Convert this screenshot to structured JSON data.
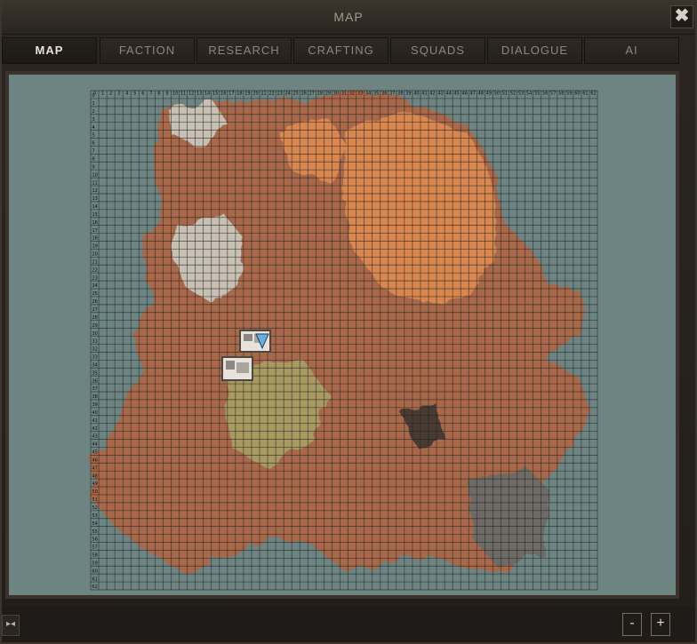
{
  "window": {
    "title": "MAP",
    "close_label": "✖"
  },
  "tabs": [
    {
      "label": "MAP",
      "active": true
    },
    {
      "label": "FACTION",
      "active": false
    },
    {
      "label": "RESEARCH",
      "active": false
    },
    {
      "label": "CRAFTING",
      "active": false
    },
    {
      "label": "SQUADS",
      "active": false
    },
    {
      "label": "DIALOGUE",
      "active": false
    },
    {
      "label": "AI",
      "active": false
    }
  ],
  "map": {
    "grid_columns": 63,
    "grid_rows": 63,
    "col_labels": [
      "0",
      "1",
      "2",
      "3",
      "4",
      "5",
      "6",
      "7",
      "8",
      "9",
      "10",
      "11",
      "12",
      "13",
      "14",
      "15",
      "16",
      "17",
      "18",
      "19",
      "20",
      "21",
      "22",
      "23",
      "24",
      "25",
      "26",
      "27",
      "28",
      "29",
      "30",
      "31",
      "32",
      "33",
      "34",
      "35",
      "36",
      "37",
      "38",
      "39",
      "40",
      "41",
      "42",
      "43",
      "44",
      "45",
      "46",
      "47",
      "48",
      "49",
      "50",
      "51",
      "52",
      "53",
      "54",
      "55",
      "56",
      "57",
      "58",
      "59",
      "60",
      "61",
      "62"
    ],
    "row_labels": [
      "0",
      "1",
      "2",
      "3",
      "4",
      "5",
      "6",
      "7",
      "8",
      "9",
      "10",
      "11",
      "12",
      "13",
      "14",
      "15",
      "16",
      "17",
      "18",
      "19",
      "20",
      "21",
      "22",
      "23",
      "24",
      "25",
      "26",
      "27",
      "28",
      "29",
      "30",
      "31",
      "32",
      "33",
      "34",
      "35",
      "36",
      "37",
      "38",
      "39",
      "40",
      "41",
      "42",
      "43",
      "44",
      "45",
      "46",
      "47",
      "48",
      "49",
      "50",
      "51",
      "52",
      "53",
      "54",
      "55",
      "56",
      "57",
      "58",
      "59",
      "60",
      "61",
      "62"
    ],
    "colors": {
      "water": "#6d8482",
      "land": "#a8684a",
      "desert": "#d9874f",
      "snow": "#c9c0b4",
      "sand": "#a99a62",
      "rock": "#6e6a66",
      "grid": "#1e2423"
    },
    "markers": [
      "player-squad-marker",
      "squad-marker"
    ]
  },
  "bottom": {
    "collapse_label": "▸◂",
    "zoom_out_label": "-",
    "zoom_in_label": "+"
  }
}
